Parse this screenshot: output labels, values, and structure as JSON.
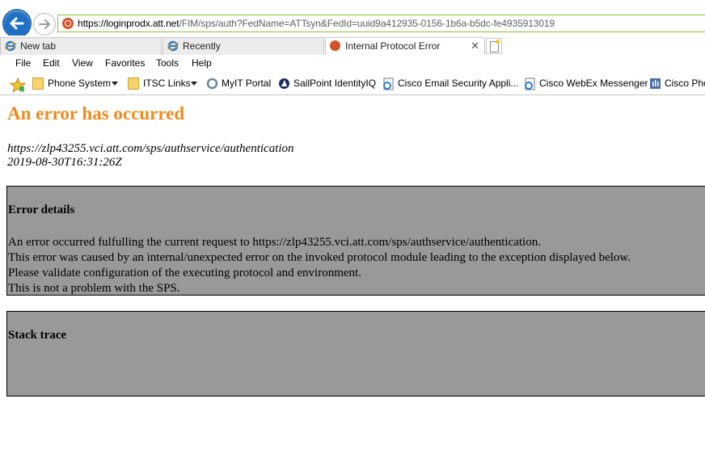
{
  "browser": {
    "url_host": "https://loginprodx.att.net",
    "url_path": "/FIM/sps/auth?FedName=ATTsyn&FedId=uuid9a412935-0156-1b6a-b5dc-fe4935913019",
    "tabs": [
      {
        "label": "New tab",
        "icon": "ie-icon"
      },
      {
        "label": "Recently",
        "icon": "ie-icon"
      },
      {
        "label": "Internal Protocol Error",
        "icon": "error-site-icon",
        "active": true
      }
    ],
    "tab_close_glyph": "✕",
    "menu": [
      "File",
      "Edit",
      "View",
      "Favorites",
      "Tools",
      "Help"
    ],
    "favorites": [
      {
        "label": "Phone System",
        "icon": "folder-icon",
        "dropdown": true
      },
      {
        "label": "ITSC Links",
        "icon": "folder-icon",
        "dropdown": true
      },
      {
        "label": "MyIT Portal",
        "icon": "ring-icon"
      },
      {
        "label": "SailPoint IdentityIQ",
        "icon": "sailpoint-icon"
      },
      {
        "label": "Cisco Email Security Appli...",
        "icon": "page-icon"
      },
      {
        "label": "Cisco WebEx Messenger",
        "icon": "page-icon"
      },
      {
        "label": "Cisco Pho",
        "icon": "cisco-icon"
      }
    ],
    "colors": {
      "address_border": "#86c440",
      "back_button": "#1f6fc4"
    }
  },
  "page": {
    "title": "An error has occurred",
    "service_url": "https://zlp43255.vci.att.com/sps/authservice/authentication",
    "timestamp": "2019-08-30T16:31:26Z",
    "error_box": {
      "heading": "Error details",
      "lines": [
        "An error occurred fulfulling the current request to https://zlp43255.vci.att.com/sps/authservice/authentication.",
        "This error was caused by an internal/unexpected error on the invoked protocol module leading to the exception displayed below.",
        "Please validate configuration of the executing protocol and environment.",
        "This is not a problem with the SPS."
      ]
    },
    "stack_box": {
      "heading": "Stack trace"
    },
    "colors": {
      "title": "#f08a1c",
      "box_background": "#999999"
    }
  }
}
